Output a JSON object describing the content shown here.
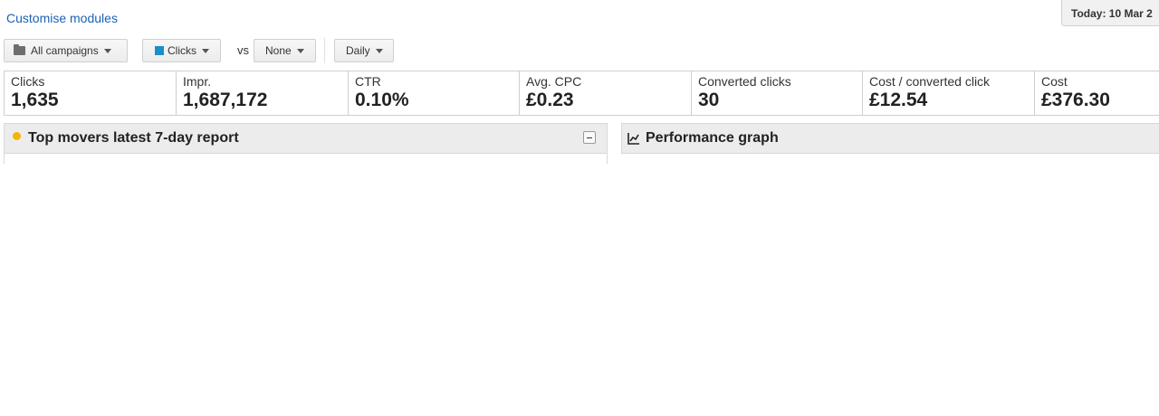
{
  "header": {
    "customise_link": "Customise modules",
    "date_label": "Today: 10 Mar 2"
  },
  "toolbar": {
    "campaigns_label": "All campaigns",
    "metric_label": "Clicks",
    "metric_color": "#1a8fc9",
    "vs_label": "vs",
    "compare_label": "None",
    "interval_label": "Daily"
  },
  "metrics": [
    {
      "label": "Clicks",
      "value": "1,635"
    },
    {
      "label": "Impr.",
      "value": "1,687,172"
    },
    {
      "label": "CTR",
      "value": "0.10%"
    },
    {
      "label": "Avg. CPC",
      "value": "£0.23"
    },
    {
      "label": "Converted clicks",
      "value": "30"
    },
    {
      "label": "Cost / converted click",
      "value": "£12.54"
    },
    {
      "label": "Cost",
      "value": "£376.30"
    }
  ],
  "panels": {
    "top_movers_title": "Top movers latest 7-day report",
    "performance_title": "Performance graph"
  },
  "icons": {
    "folder": "folder-icon",
    "bulb": "lightbulb-icon",
    "chart": "line-chart-icon",
    "collapse": "minus-icon"
  }
}
